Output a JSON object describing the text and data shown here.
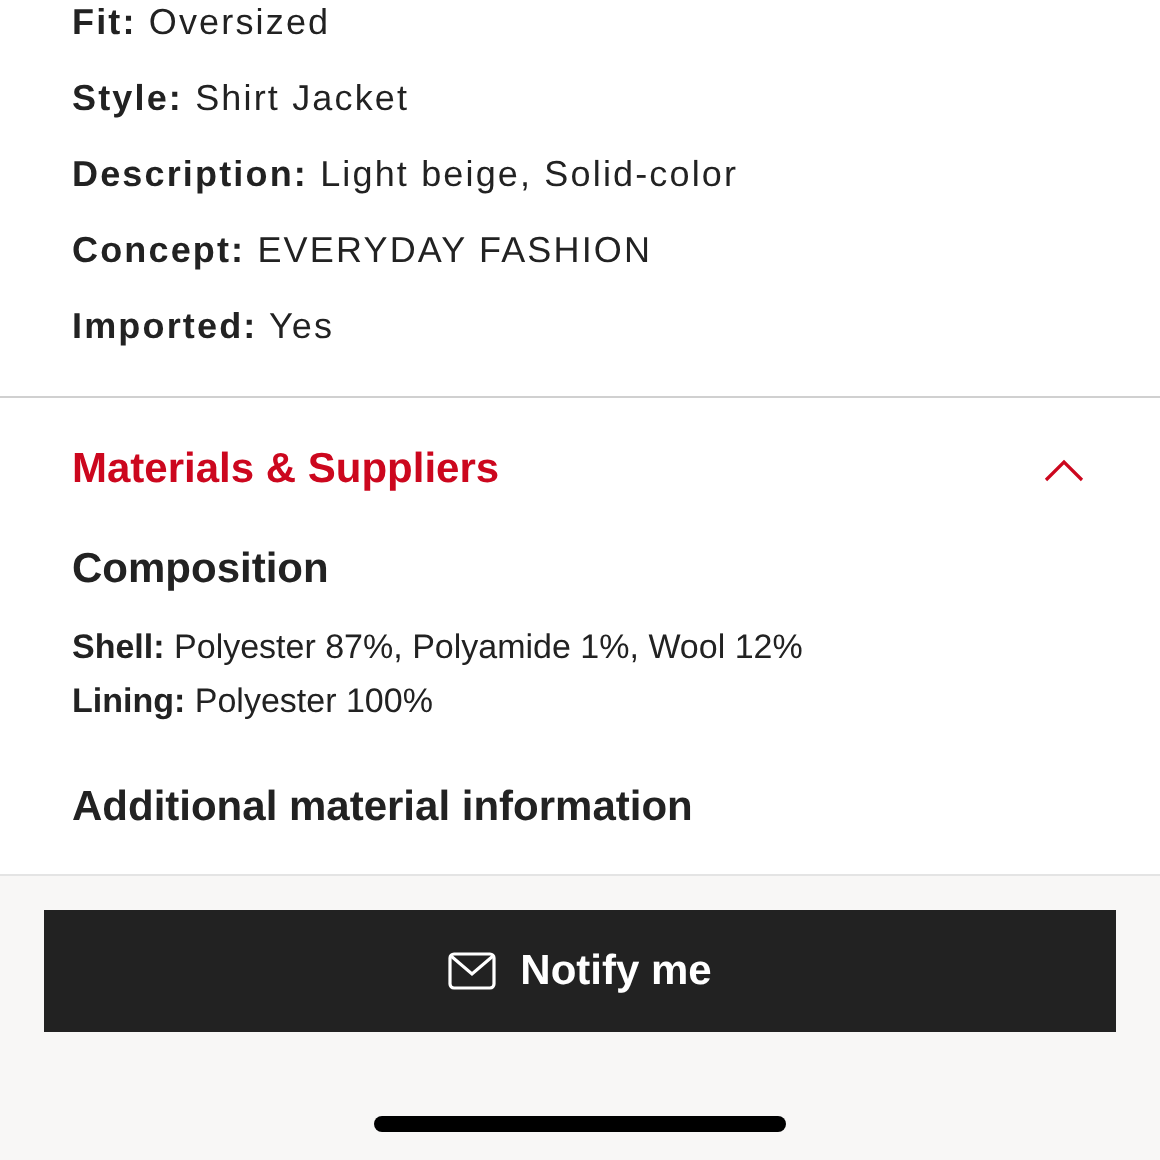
{
  "attributes": [
    "**Fit:** Oversized",
    "**Style:** Shirt Jacket",
    "**Description:** Light beige, Solid-color",
    "**Concept:** EVERYDAY FASHION",
    "**Imported:** Yes"
  ],
  "section": {
    "title": "Materials & Suppliers",
    "expanded": true,
    "heading": "Composition",
    "lines": [
      "**Shell:** Polyester 87%, Polyamide 1%, Wool 12%",
      "**Lining:** Polyester 100%"
    ],
    "next_heading": "Additional material information"
  },
  "button": {
    "label": "Notify me"
  }
}
